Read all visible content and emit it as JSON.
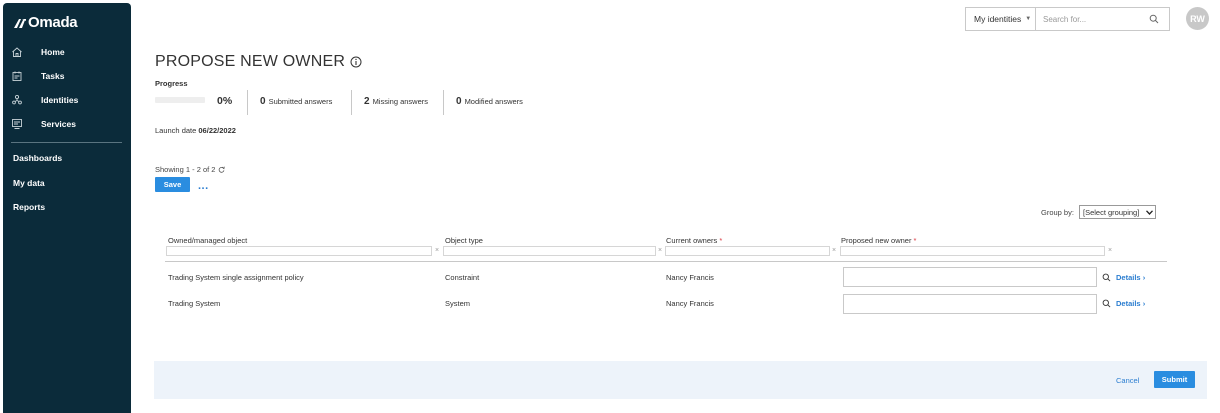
{
  "app": {
    "logo_text": "Omada"
  },
  "sidebar": {
    "items": [
      {
        "label": "Home",
        "icon": "home-icon"
      },
      {
        "label": "Tasks",
        "icon": "tasks-icon"
      },
      {
        "label": "Identities",
        "icon": "identities-icon"
      },
      {
        "label": "Services",
        "icon": "services-icon"
      }
    ],
    "plain_items": [
      "Dashboards",
      "My data",
      "Reports"
    ]
  },
  "topbar": {
    "scope_select": "My identities",
    "search_placeholder": "Search for...",
    "avatar_initials": "RW"
  },
  "page": {
    "title": "PROPOSE NEW OWNER",
    "progress_label": "Progress",
    "progress_percent": "0%",
    "progress_value": 0,
    "submitted_count": "0",
    "submitted_label": "Submitted answers",
    "missing_count": "2",
    "missing_label": "Missing answers",
    "modified_count": "0",
    "modified_label": "Modified answers",
    "launch_label": "Launch date",
    "launch_date": "06/22/2022"
  },
  "toolbar": {
    "showing_text": "Showing 1 - 2 of 2",
    "save_label": "Save",
    "more_label": "...",
    "group_by_label": "Group by:",
    "group_by_value": "[Select grouping]"
  },
  "table": {
    "columns": [
      "Owned/managed object",
      "Object type",
      "Current owners",
      "Proposed new owner"
    ],
    "rows": [
      {
        "object": "Trading System single assignment policy",
        "type": "Constraint",
        "owners": "Nancy Francis",
        "proposed": "",
        "details": "Details"
      },
      {
        "object": "Trading System",
        "type": "System",
        "owners": "Nancy Francis",
        "proposed": "",
        "details": "Details"
      }
    ]
  },
  "footer": {
    "cancel_label": "Cancel",
    "submit_label": "Submit"
  },
  "colors": {
    "sidebar": "#0b2b3a",
    "accent": "#2a8de0",
    "link": "#2a7dd0",
    "required": "#d9363e"
  }
}
